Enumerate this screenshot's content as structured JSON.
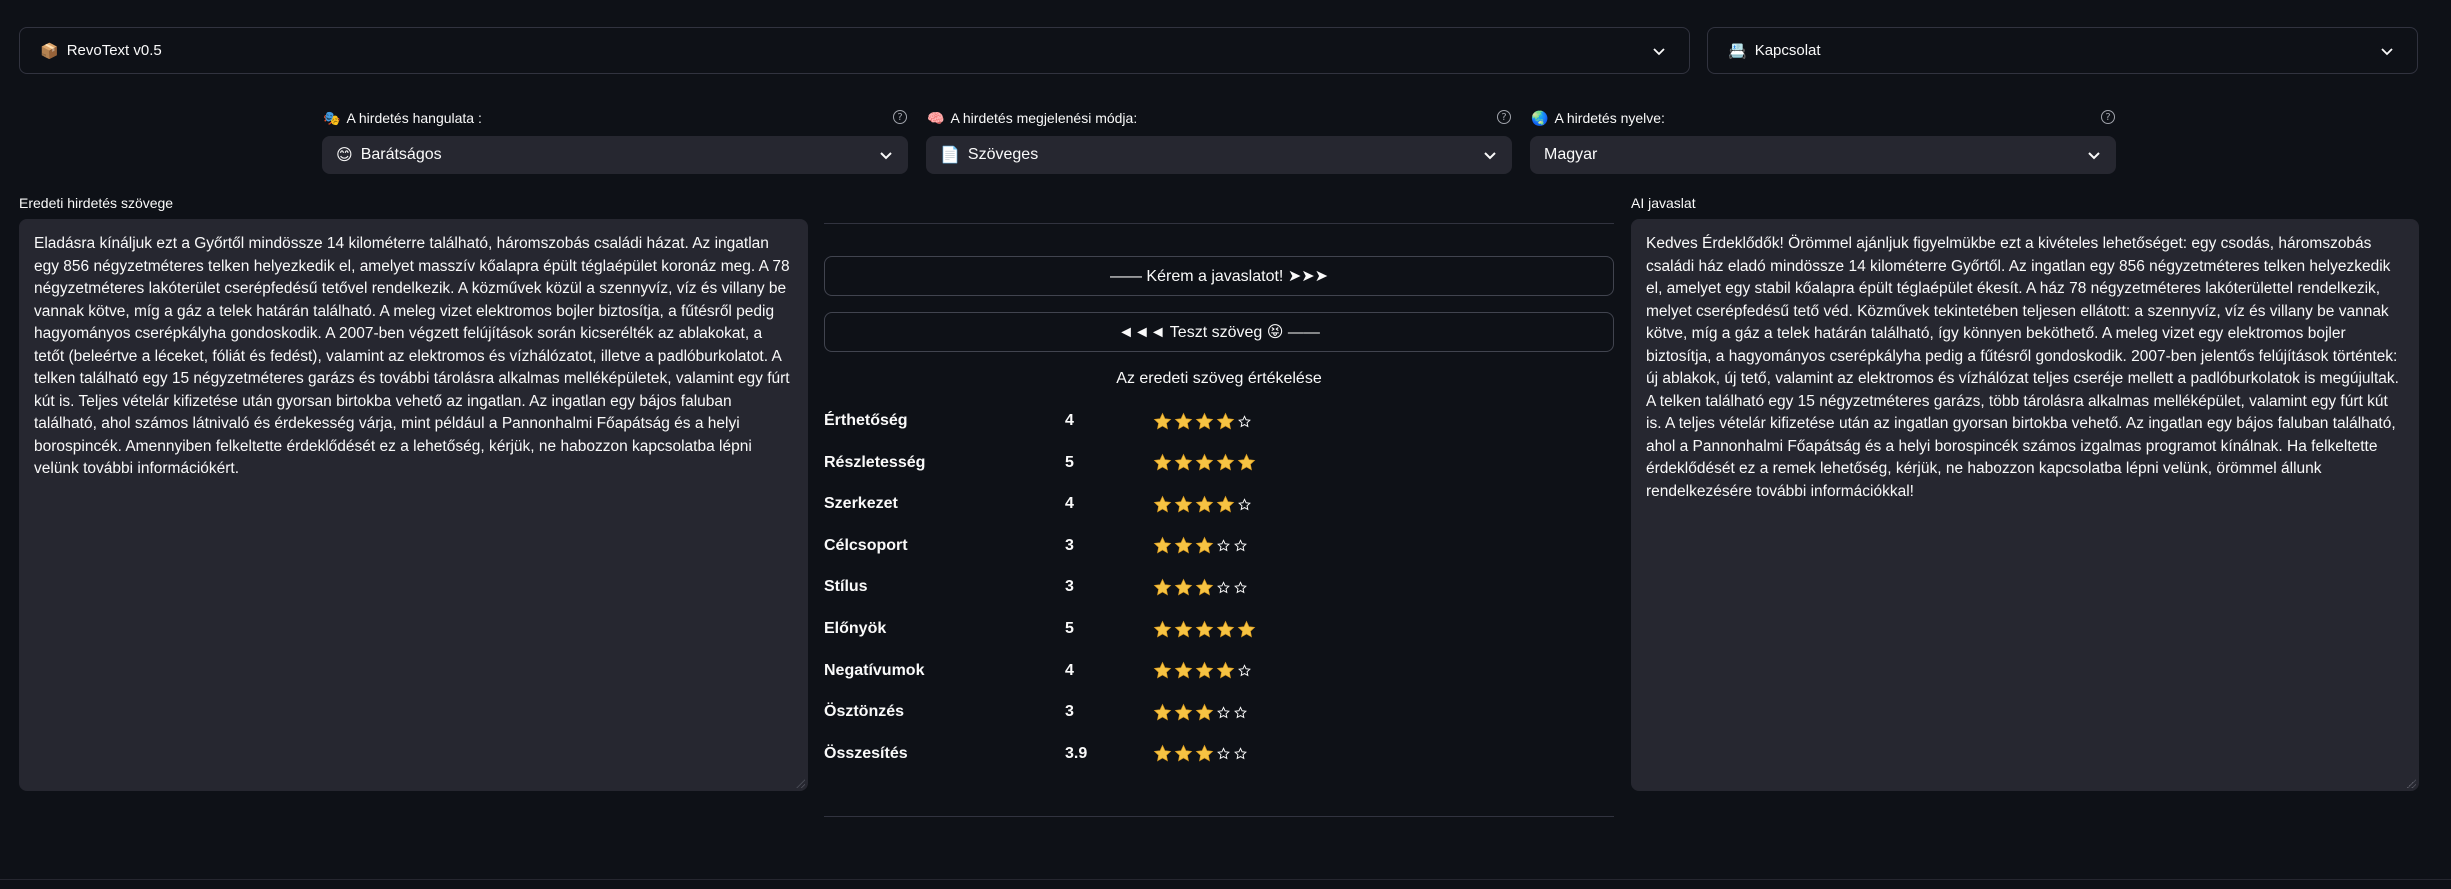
{
  "expanders": {
    "left": {
      "emoji": "📦",
      "title": "RevoText v0.5"
    },
    "right": {
      "emoji": "📇",
      "title": "Kapcsolat"
    }
  },
  "selects": [
    {
      "label_emoji": "🎭",
      "label": "A hirdetés hangulata :",
      "value_emoji": "😊",
      "value": "Barátságos"
    },
    {
      "label_emoji": "🧠",
      "label": "A hirdetés megjelenési módja:",
      "value_emoji": "📄",
      "value": "Szöveges"
    },
    {
      "label_emoji": "🌏",
      "label": "A hirdetés nyelve:",
      "value_emoji": "",
      "value": "Magyar"
    }
  ],
  "help_glyph": "?",
  "original": {
    "label": "Eredeti hirdetés szövege",
    "text": "Eladásra kínáljuk ezt a Győrtől mindössze 14 kilométerre található, háromszobás családi házat. Az ingatlan egy 856 négyzetméteres telken helyezkedik el, amelyet masszív kőalapra épült téglaépület koronáz meg. A 78 négyzetméteres lakóterület cserépfedésű tetővel rendelkezik. A közművek közül a szennyvíz, víz és villany be vannak kötve, míg a gáz a telek határán található. A meleg vizet elektromos bojler biztosítja, a fűtésről pedig hagyományos cserépkályha gondoskodik. A 2007-ben végzett felújítások során kicserélték az ablakokat, a tetőt (beleértve a léceket, fóliát és fedést), valamint az elektromos és vízhálózatot, illetve a padlóburkolatot. A telken található egy 15 négyzetméteres garázs és további tárolásra alkalmas melléképületek, valamint egy fúrt kút is. Teljes vételár kifizetése után gyorsan birtokba vehető az ingatlan. Az ingatlan egy bájos faluban található, ahol számos látnivaló és érdekesség várja, mint például a Pannonhalmi Főapátság és a helyi borospincék. Amennyiben felkeltette érdeklődését ez a lehetőség, kérjük, ne habozzon kapcsolatba lépni velünk további információkért."
  },
  "suggestion": {
    "label": "AI javaslat",
    "text": "Kedves Érdeklődők! Örömmel ajánljuk figyelmükbe ezt a kivételes lehetőséget: egy csodás, háromszobás családi ház eladó mindössze 14 kilométerre Győrtől. Az ingatlan egy 856 négyzetméteres telken helyezkedik el, amelyet egy stabil kőalapra épült téglaépület ékesít. A ház 78 négyzetméteres lakóterülettel rendelkezik, melyet cserépfedésű tető véd. Közművek tekintetében teljesen ellátott: a szennyvíz, víz és villany be vannak kötve, míg a gáz a telek határán található, így könnyen beköthető. A meleg vizet egy elektromos bojler biztosítja, a hagyományos cserépkályha pedig a fűtésről gondoskodik. 2007-ben jelentős felújítások történtek: új ablakok, új tető, valamint az elektromos és vízhálózat teljes cseréje mellett a padlóburkolatok is megújultak. A telken található egy 15 négyzetméteres garázs, több tárolásra alkalmas melléképület, valamint egy fúrt kút is. A teljes vételár kifizetése után az ingatlan gyorsan birtokba vehető. Az ingatlan egy bájos faluban található, ahol a Pannonhalmi Főapátság és a helyi borospincék számos izgalmas programot kínálnak. Ha felkeltette érdeklődését ez a remek lehetőség, kérjük, ne habozzon kapcsolatba lépni velünk, örömmel állunk rendelkezésére további információkkal!"
  },
  "buttons": {
    "suggest": "—— Kérem a javaslatot! ➤➤➤",
    "test": "◄◄◄ Teszt szöveg 😝 ——"
  },
  "evaluation": {
    "title": "Az eredeti szöveg értékelése",
    "ratings": [
      {
        "category": "Érthetőség",
        "score": "4",
        "stars": 4
      },
      {
        "category": "Részletesség",
        "score": "5",
        "stars": 5
      },
      {
        "category": "Szerkezet",
        "score": "4",
        "stars": 4
      },
      {
        "category": "Célcsoport",
        "score": "3",
        "stars": 3
      },
      {
        "category": "Stílus",
        "score": "3",
        "stars": 3
      },
      {
        "category": "Előnyök",
        "score": "5",
        "stars": 5
      },
      {
        "category": "Negatívumok",
        "score": "4",
        "stars": 4
      },
      {
        "category": "Ösztönzés",
        "score": "3",
        "stars": 3
      },
      {
        "category": "Összesítés",
        "score": "3.9",
        "stars": 3
      }
    ],
    "max_stars": 5
  },
  "colors": {
    "background": "#0e1117",
    "field": "#262730",
    "border": "#31333f",
    "star": "#f6c343"
  }
}
